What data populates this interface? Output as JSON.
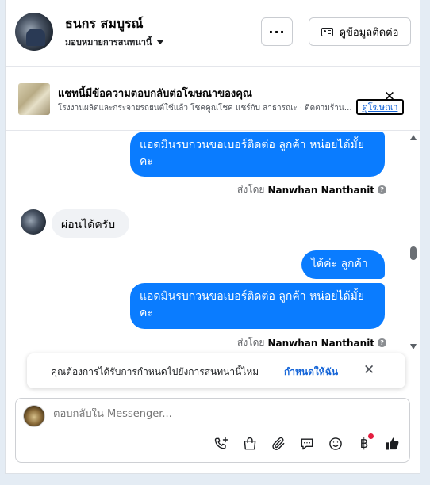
{
  "header": {
    "name": "ธนกร สมบูรณ์",
    "assign_label": "มอบหมายการสนทนานี้",
    "more_label": "···",
    "contact_label": "ดูข้อมูลติดต่อ"
  },
  "ad": {
    "title": "แชทนี้มีข้อความตอบกลับต่อโฆษณาของคุณ",
    "description": "โรงงานผลิตและกระจายรถยนต์ใช้แล้ว โชคคูณโชค แชร์กับ สาธารณะ · ติดตามร้านรถมือสองคุณภาพ",
    "link_label": "ดูโฆษณา",
    "close_label": "✕"
  },
  "messages": [
    {
      "direction": "out",
      "text": "แอดมินรบกวนขอเบอร์ติดต่อ ลูกค้า   หน่อยได้มั้ยคะ"
    },
    {
      "direction": "in",
      "text": "ผ่อนได้ครับ"
    },
    {
      "direction": "out",
      "text": "ได้ค่ะ  ลูกค้า"
    },
    {
      "direction": "out",
      "text": "แอดมินรบกวนขอเบอร์ติดต่อ ลูกค้า  หน่อยได้มั้ยคะ"
    }
  ],
  "sent_by": {
    "prefix": "ส่งโดย",
    "agent": "Nanwhan Nanthanit",
    "info_icon": "?"
  },
  "notice": {
    "text": "คุณต้องการได้รับการกำหนดไปยังการสนทนานี้ไหม",
    "link_label": "กำหนดให้ฉัน",
    "close_label": "✕"
  },
  "composer": {
    "placeholder": "ตอบกลับใน Messenger..."
  },
  "tools": {
    "baht_symbol": "฿"
  },
  "colors": {
    "accent": "#0a7cff",
    "link": "#1565d8",
    "badge": "#e41e3f",
    "background": "#e4ecf4"
  }
}
